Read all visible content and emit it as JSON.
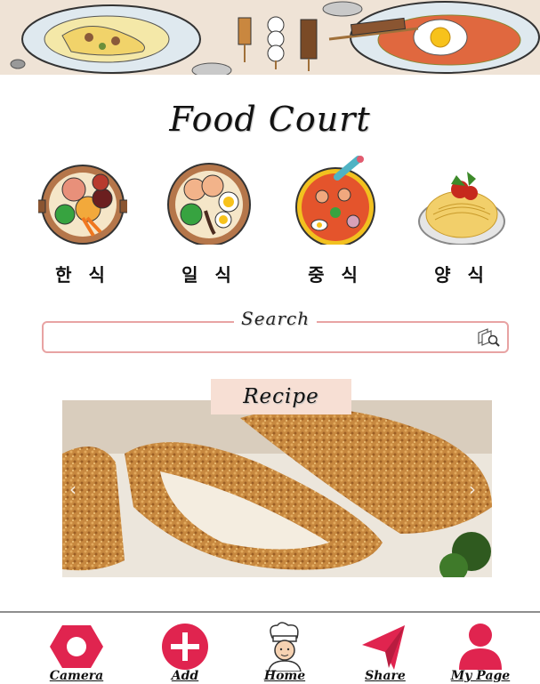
{
  "app": {
    "title": "Food Court"
  },
  "categories": [
    {
      "label": "한 식",
      "icon": "korean-food-bowl-icon"
    },
    {
      "label": "일 식",
      "icon": "japanese-food-bowl-icon"
    },
    {
      "label": "중 식",
      "icon": "chinese-food-bowl-icon"
    },
    {
      "label": "양 식",
      "icon": "western-pasta-plate-icon"
    }
  ],
  "search": {
    "legend": "Search",
    "placeholder": "",
    "value": "",
    "icon": "search-icon"
  },
  "recipe": {
    "label": "Recipe",
    "image": "fried-cutlet-photo"
  },
  "nav": {
    "items": [
      {
        "label": "Camera",
        "icon": "camera-hexagon-icon"
      },
      {
        "label": "Add",
        "icon": "add-circle-icon"
      },
      {
        "label": "Home",
        "icon": "chef-icon"
      },
      {
        "label": "Share",
        "icon": "paper-plane-icon"
      },
      {
        "label": "My Page",
        "icon": "user-icon"
      }
    ]
  },
  "colors": {
    "banner": "#efe3d6",
    "accent": "#e0244f",
    "search_border": "#e8a3a3",
    "recipe_tab": "#f7dfd4"
  }
}
